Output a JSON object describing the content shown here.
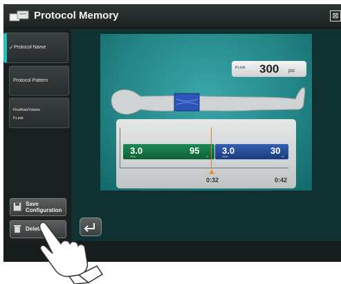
{
  "window": {
    "title": "Protocol Memory",
    "close_glyph": "⊠"
  },
  "sidebar": {
    "items": [
      {
        "label": "Protocol Name",
        "active": true
      },
      {
        "label": "Protocol Pattern",
        "active": false
      },
      {
        "line1": "FlowRate/Volume",
        "line2": "P.Limit",
        "active": false
      }
    ],
    "buttons": {
      "save_line1": "Save",
      "save_line2": "Configuration",
      "delete": "Delete"
    }
  },
  "pressure_limit": {
    "label": "P.Limit",
    "value": "300",
    "unit": "psi"
  },
  "phases": [
    {
      "rate": "3.0",
      "rate_unit": "ml/sec",
      "volume": "95",
      "volume_unit": "ml",
      "color": "#1d8a55"
    },
    {
      "rate": "3.0",
      "rate_unit": "ml/sec",
      "volume": "30",
      "volume_unit": "ml",
      "color": "#3460b0"
    }
  ],
  "timeline": {
    "marker_time": "0:32",
    "end_time": "0:42",
    "marker_color": "#f08a2e"
  },
  "icons": [
    "protocol-memory-icon",
    "close-icon",
    "check-icon",
    "save-icon",
    "trash-icon",
    "return-arrow-icon",
    "patient-body-icon",
    "pointing-hand-icon"
  ]
}
